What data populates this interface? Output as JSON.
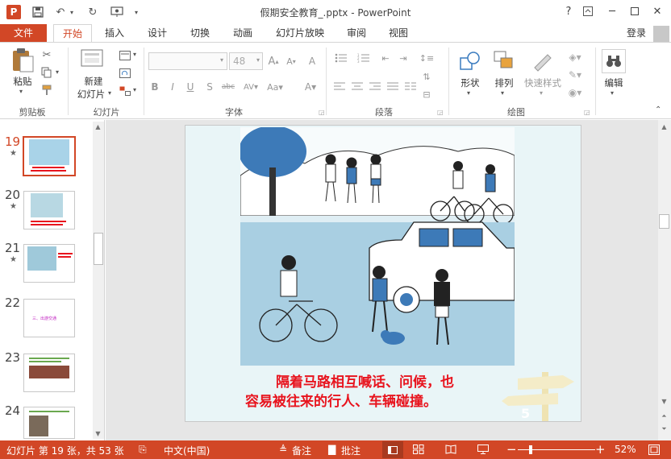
{
  "app": {
    "title": "假期安全教育_.pptx - PowerPoint",
    "logo": "P",
    "help": "?",
    "signin": "登录"
  },
  "tabs": [
    "文件",
    "开始",
    "插入",
    "设计",
    "切换",
    "动画",
    "幻灯片放映",
    "审阅",
    "视图"
  ],
  "ribbon": {
    "paste": "粘贴",
    "clipboard": "剪贴板",
    "new_slide_1": "新建",
    "new_slide_2": "幻灯片",
    "slides_group": "幻灯片",
    "font_size": "48",
    "font_group": "字体",
    "paragraph_group": "段落",
    "shape": "形状",
    "arrange": "排列",
    "quick_style": "快速样式",
    "drawing_group": "绘图",
    "edit": "编辑"
  },
  "thumbnails": [
    {
      "num": "19",
      "star": "★",
      "selected": true
    },
    {
      "num": "20",
      "star": "★",
      "selected": false
    },
    {
      "num": "21",
      "star": "★",
      "selected": false
    },
    {
      "num": "22",
      "star": "",
      "selected": false,
      "text": "三、出游交通"
    },
    {
      "num": "23",
      "star": "",
      "selected": false
    },
    {
      "num": "24",
      "star": "",
      "selected": false
    }
  ],
  "slide": {
    "caption_line1": "隔着马路相互喊话、问候，也",
    "caption_line2": "容易被往来的行人、车辆碰撞。",
    "page_mark": "5"
  },
  "status": {
    "slide_info": "幻灯片 第 19 张，共 53 张",
    "language": "中文(中国)",
    "notes": "备注",
    "comments": "批注",
    "zoom": "52%"
  },
  "colors": {
    "accent": "#d24726",
    "caption": "#e8141e"
  }
}
